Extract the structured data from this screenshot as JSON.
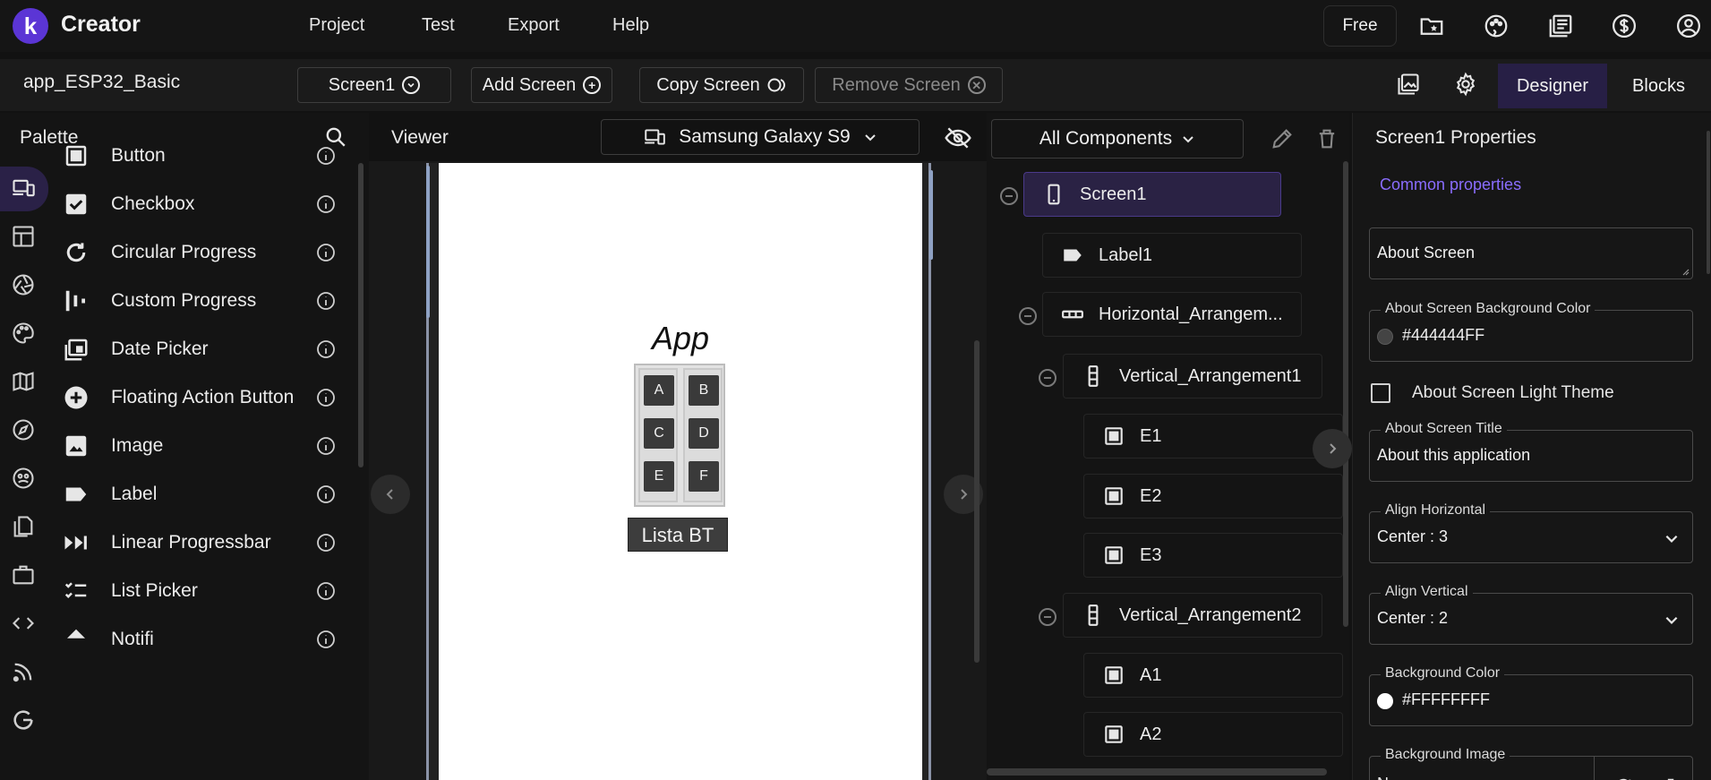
{
  "app": {
    "logo_letter": "k",
    "brand": "Creator"
  },
  "menu": [
    "Project",
    "Test",
    "Export",
    "Help"
  ],
  "top_right": {
    "plan": "Free",
    "icons": [
      "folder-star-icon",
      "palette-icon",
      "library-icon",
      "dollar-icon",
      "account-icon"
    ]
  },
  "toolbar": {
    "project_name": "app_ESP32_Basic",
    "screen_select": "Screen1",
    "add_screen": "Add Screen",
    "copy_screen": "Copy Screen",
    "remove_screen": "Remove Screen",
    "designer": "Designer",
    "blocks": "Blocks"
  },
  "palette": {
    "title": "Palette",
    "items": [
      {
        "label": "Button",
        "icon": "button-icon"
      },
      {
        "label": "Checkbox",
        "icon": "checkbox-icon"
      },
      {
        "label": "Circular Progress",
        "icon": "circular-progress-icon"
      },
      {
        "label": "Custom Progress",
        "icon": "custom-progress-icon"
      },
      {
        "label": "Date Picker",
        "icon": "date-picker-icon"
      },
      {
        "label": "Floating Action Button",
        "icon": "fab-icon"
      },
      {
        "label": "Image",
        "icon": "image-icon"
      },
      {
        "label": "Label",
        "icon": "label-icon"
      },
      {
        "label": "Linear Progressbar",
        "icon": "linear-progress-icon"
      },
      {
        "label": "List Picker",
        "icon": "list-picker-icon"
      },
      {
        "label": "Notifi",
        "icon": "notifier-icon"
      }
    ]
  },
  "viewer": {
    "title": "Viewer",
    "device": "Samsung Galaxy S9",
    "screen": {
      "app_title": "App",
      "buttons_left": [
        "A",
        "C",
        "E"
      ],
      "buttons_right": [
        "B",
        "D",
        "F"
      ],
      "lista_button": "Lista BT"
    }
  },
  "components": {
    "filter": "All Components",
    "tree": [
      {
        "label": "Screen1",
        "icon": "phone-icon",
        "selected": true
      },
      {
        "label": "Label1",
        "icon": "label-icon"
      },
      {
        "label": "Horizontal_Arrangem...",
        "icon": "horizontal-arrangement-icon"
      },
      {
        "label": "Vertical_Arrangement1",
        "icon": "vertical-arrangement-icon"
      },
      {
        "label": "E1",
        "icon": "button-icon"
      },
      {
        "label": "E2",
        "icon": "button-icon"
      },
      {
        "label": "E3",
        "icon": "button-icon"
      },
      {
        "label": "Vertical_Arrangement2",
        "icon": "vertical-arrangement-icon"
      },
      {
        "label": "A1",
        "icon": "button-icon"
      },
      {
        "label": "A2",
        "icon": "button-icon"
      }
    ]
  },
  "properties": {
    "title": "Screen1 Properties",
    "section": "Common properties",
    "about_screen": "About Screen",
    "bg_color_label": "About Screen Background Color",
    "bg_color_value": "#444444FF",
    "light_theme_label": "About Screen Light Theme",
    "about_title_label": "About Screen Title",
    "about_title_value": "About this application",
    "align_h_label": "Align Horizontal",
    "align_h_value": "Center : 3",
    "align_v_label": "Align Vertical",
    "align_v_value": "Center : 2",
    "background_color_label": "Background Color",
    "background_color_value": "#FFFFFFFF",
    "background_image_label": "Background Image",
    "background_image_value": "N"
  },
  "colors": {
    "accent": "#5b35d5",
    "accent_text": "#8a6dff",
    "selected_bg": "#2a2244",
    "dark_bg": "#121212"
  }
}
